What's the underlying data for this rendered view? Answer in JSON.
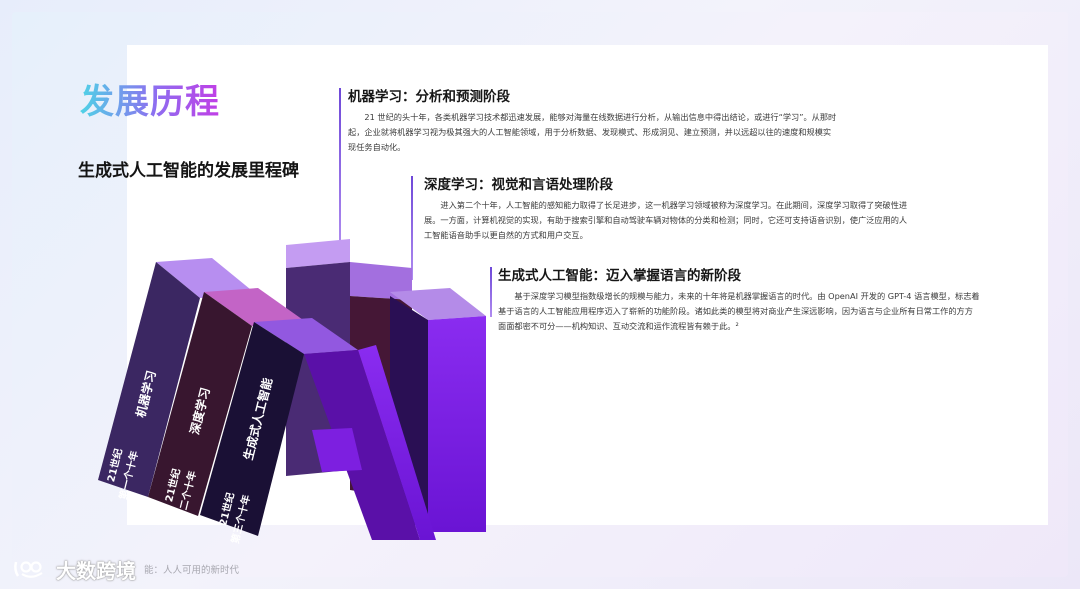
{
  "page": {
    "title": "发展历程",
    "subtitle": "生成式人工智能的发展里程碑"
  },
  "stages": [
    {
      "heading": "机器学习：分析和预测阶段",
      "body": "21 世纪的头十年，各类机器学习技术都迅速发展，能够对海量在线数据进行分析，从输出信息中得出结论，或进行“学习”。从那时起，企业就将机器学习视为极其强大的人工智能领域，用于分析数据、发现模式、形成洞见、建立预测，并以远超以往的速度和规模实现任务自动化。"
    },
    {
      "heading": "深度学习：视觉和言语处理阶段",
      "body": "进入第二个十年，人工智能的感知能力取得了长足进步，这一机器学习领域被称为深度学习。在此期间，深度学习取得了突破性进展。一方面，计算机视觉的实现，有助于搜索引擎和自动驾驶车辆对物体的分类和检测；同时，它还可支持语音识别，使广泛应用的人工智能语音助手以更自然的方式和用户交互。"
    },
    {
      "heading": "生成式人工智能：迈入掌握语言的新阶段",
      "body": "基于深度学习模型指数级增长的规模与能力，未来的十年将是机器掌握语言的时代。由 OpenAI 开发的 GPT-4 语言模型，标志着基于语言的人工智能应用程序迈入了崭新的功能阶段。诸如此类的模型将对商业产生深远影响，因为语言与企业所有日常工作的方方面面都密不可分——机构知识、互动交流和运作流程皆有赖于此。²"
    }
  ],
  "graphic": {
    "letters": "AI",
    "panels": [
      {
        "label": "机器学习",
        "era_line1": "21世纪",
        "era_line2": "第一个十年"
      },
      {
        "label": "深度学习",
        "era_line1": "21世纪",
        "era_line2": "第二个十年"
      },
      {
        "label": "生成式人工智能",
        "era_line1": "21世纪",
        "era_line2": "第三个十年"
      }
    ],
    "colors": {
      "panel_1": "#3b2762",
      "panel_2": "#38162f",
      "panel_3": "#1a1035",
      "letter_front": "#7d1fe0",
      "letter_side": "#5a10a8",
      "letter_top": "#b690ee"
    }
  },
  "watermark": {
    "brand": "大数跨境",
    "caption": "能：人人可用的新时代"
  },
  "colors": {
    "accent": "#7b3fe4",
    "title_gradient_start": "#4fd3e6",
    "title_gradient_end": "#c13ee6"
  }
}
